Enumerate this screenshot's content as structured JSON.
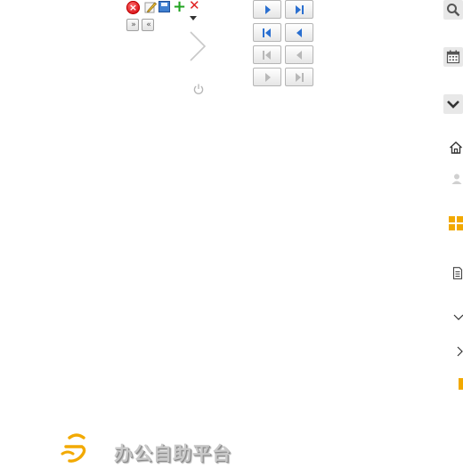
{
  "toolbar": {
    "close_glyph": "×",
    "add_glyph": "+",
    "delete_glyph": "✕",
    "next_page_glyph": "»",
    "prev_page_glyph": "«"
  },
  "icons": {
    "toolbar": [
      "close-icon",
      "edit-pencil-icon",
      "save-disk-icon",
      "add-icon",
      "delete-icon",
      "dropdown-caret-icon",
      "next-page-icon",
      "prev-page-icon"
    ],
    "misc": [
      "chevron-right-large-icon",
      "power-icon"
    ],
    "pager": [
      "next-icon",
      "last-icon",
      "first-icon",
      "prev-icon",
      "first-disabled-icon",
      "prev-disabled-icon",
      "next-disabled-icon",
      "last-disabled-icon"
    ],
    "rail": [
      "search-icon",
      "calendar-icon",
      "chevron-down-icon",
      "home-icon",
      "user-icon",
      "grid-icon",
      "document-icon",
      "chevron-down-small-icon",
      "chevron-right-small-icon",
      "orange-marker-icon"
    ]
  },
  "colors": {
    "pager_arrow": "#2a6fd0",
    "pager_arrow_disabled": "#b8b8b8",
    "grid_icon": "#f2a900",
    "brand_logo": "#f2a900",
    "brand_text": "#c9c9c9"
  },
  "brand": {
    "name": "办公自助平台"
  }
}
